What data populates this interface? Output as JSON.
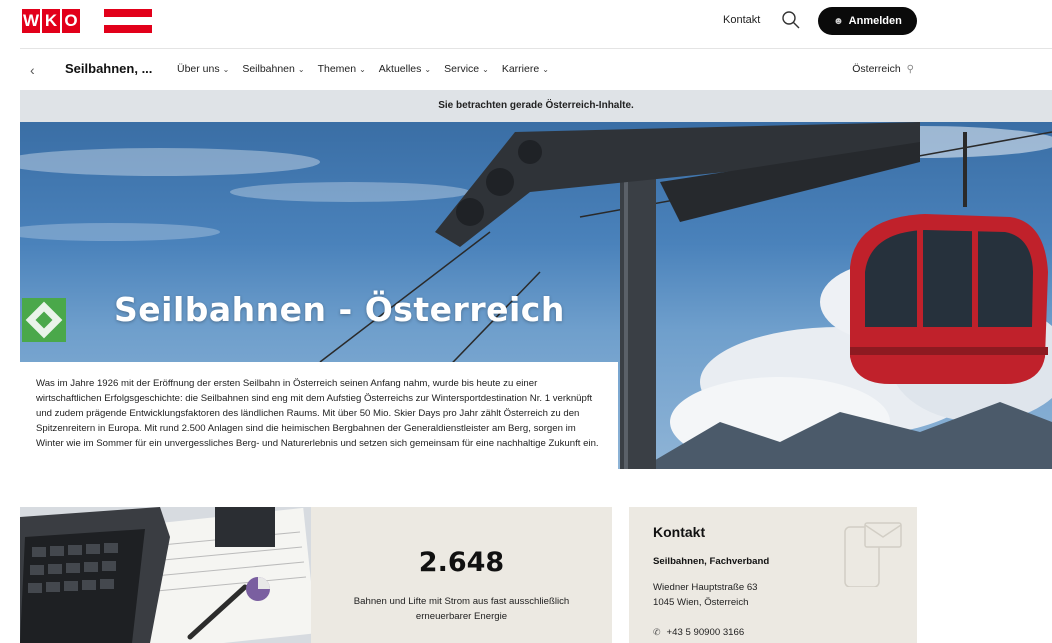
{
  "header": {
    "logo_text": "WKO",
    "kontakt": "Kontakt",
    "login": "Anmelden"
  },
  "nav": {
    "title": "Seilbahnen, ...",
    "items": [
      "Über uns",
      "Seilbahnen",
      "Themen",
      "Aktuelles",
      "Service",
      "Karriere"
    ],
    "region": "Österreich"
  },
  "notice": "Sie betrachten gerade Österreich-Inhalte.",
  "hero": {
    "title": "Seilbahnen - Österreich",
    "text": "Was im Jahre 1926 mit der Eröffnung der ersten Seilbahn in Österreich seinen Anfang nahm, wurde bis heute zu einer wirtschaftlichen Erfolgsgeschichte: die Seilbahnen sind eng mit dem Aufstieg Österreichs zur Wintersportdestination Nr. 1 verknüpft und zudem prägende Entwicklungsfaktoren des ländlichen Raums. Mit über 50 Mio. Skier Days pro Jahr zählt Österreich zu den Spitzenreitern in Europa. Mit rund 2.500 Anlagen sind die heimischen Bergbahnen der Generaldienstleister am Berg, sorgen im Winter wie im Sommer für ein unvergessliches Berg- und Naturerlebnis und setzen sich gemeinsam für eine nachhaltige Zukunft ein."
  },
  "stat": {
    "number": "2.648",
    "description": "Bahnen und Lifte mit Strom aus fast ausschließlich erneuerbarer Energie"
  },
  "contact": {
    "heading": "Kontakt",
    "org": "Seilbahnen, Fachverband",
    "address_line1": "Wiedner Hauptstraße 63",
    "address_line2": "1045 Wien, Österreich",
    "phone": "+43 5 90900 3166"
  },
  "colors": {
    "brand_red": "#e2001a",
    "login_bg": "#0a0a0a",
    "badge_green": "#4aa84a",
    "card_bg": "#ece9e2",
    "notice_bg": "#dfe3e7"
  },
  "icons": [
    "search-icon",
    "user-icon",
    "chevron-left-icon",
    "chevron-down-icon",
    "location-pin-icon",
    "phone-icon",
    "mail-icon"
  ]
}
